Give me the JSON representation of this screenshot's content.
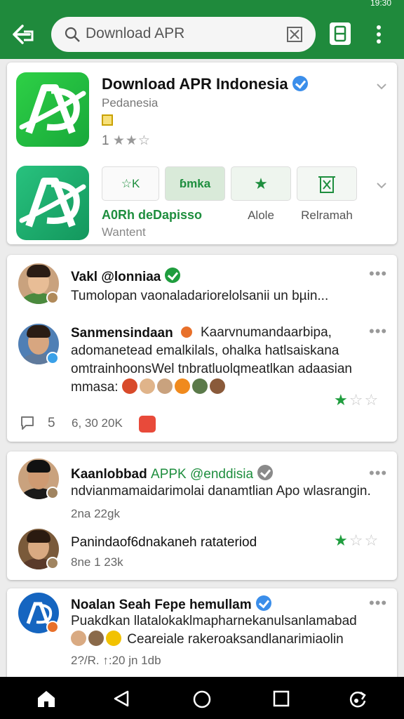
{
  "status_bar": {
    "time": "19:30"
  },
  "search": {
    "value": "Download APR"
  },
  "app": {
    "title": "Download APR Indonesia",
    "developer": "Pedanesia",
    "rating": "1",
    "stars": "★★☆",
    "logo_text": "AD"
  },
  "actions": {
    "btn1": "☆K",
    "btn2": "ɓmka",
    "btn3": "★",
    "btn4": "",
    "label_main": "A0Rh deDapisso",
    "label_sub": "Wantent",
    "label3": "Alole",
    "label4": "Relramah"
  },
  "reviews": [
    {
      "name": "Vakl @lonniaa",
      "text": [
        "Tumolopan vaonaladariorelolsanii un bµin..."
      ]
    },
    {
      "name": "Sanmensindaan",
      "text": [
        "Kaarvnumandaarbipa,",
        "adomanetead emalkilals, ohalka hatlsaiskana",
        "omtrainhoonsWel tnbratluolqmeatlkan adaasian",
        "mmasa:"
      ],
      "comments": "5",
      "likes": "6, 30 20K"
    },
    {
      "name": "Kaanlobbad",
      "handle": "APPK @enddisia",
      "text": [
        "ndvianmamaidarimolai danamtlian Apo wlasrangin."
      ],
      "meta": "2na 22gk"
    },
    {
      "name": "Panindaof6dnakaneh ratateriod",
      "meta": "8ne 1 23k"
    },
    {
      "name": "Noalan Seah Fepe hemullam",
      "text": [
        "Puakdkan llatalokaklmapharnekanulsanlamabad",
        "Ceareiale rakeroaksandlanarimiaolin"
      ],
      "meta": "2?/R. ↑:20 jn 1db"
    }
  ],
  "colors": {
    "brand_green": "#1f8a3c",
    "star_green": "#1f9d3e",
    "verified_blue": "#3b8eea"
  },
  "icons": [
    "back-icon",
    "search-icon",
    "clear-icon",
    "share-icon",
    "more-icon",
    "verified-icon",
    "chevron-down-icon",
    "comment-icon",
    "home-icon",
    "back-nav-icon",
    "recents-icon",
    "rotate-icon"
  ]
}
